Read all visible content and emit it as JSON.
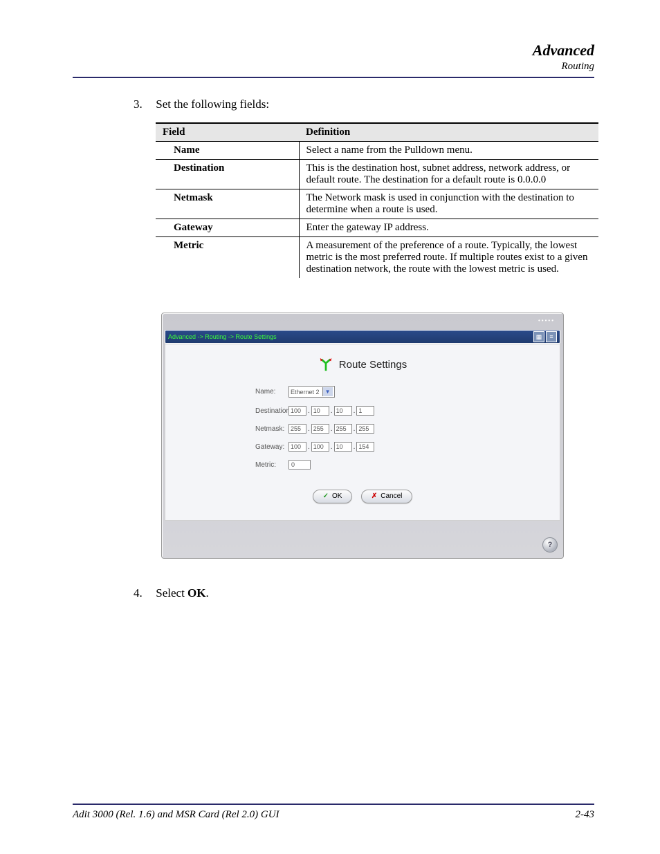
{
  "header": {
    "title": "Advanced",
    "subtitle": "Routing"
  },
  "step3": {
    "num": "3.",
    "text": "Set the following fields:"
  },
  "fields_table": {
    "headers": {
      "field": "Field",
      "definition": "Definition"
    },
    "rows": [
      {
        "name": "Name",
        "def": "Select a name from the Pulldown menu."
      },
      {
        "name": "Destination",
        "def": "This is the destination host, subnet address, network address, or default route. The destination for a default route is 0.0.0.0"
      },
      {
        "name": "Netmask",
        "def": "The Network mask is used in conjunction with the destination to determine when a route is used."
      },
      {
        "name": "Gateway",
        "def": "Enter the gateway IP address."
      },
      {
        "name": "Metric",
        "def": "A measurement of the preference of a route. Typically, the lowest metric is the most preferred route. If multiple routes exist to a given destination network, the route with the lowest metric is used."
      }
    ]
  },
  "app": {
    "breadcrumb": "Advanced -> Routing -> Route Settings",
    "title": "Route Settings",
    "labels": {
      "name": "Name:",
      "destination": "Destination:",
      "netmask": "Netmask:",
      "gateway": "Gateway:",
      "metric": "Metric:"
    },
    "values": {
      "name": "Ethernet 2",
      "destination": [
        "100",
        "10",
        "10",
        "1"
      ],
      "netmask": [
        "255",
        "255",
        "255",
        "255"
      ],
      "gateway": [
        "100",
        "100",
        "10",
        "154"
      ],
      "metric": "0"
    },
    "buttons": {
      "ok": "OK",
      "cancel": "Cancel"
    }
  },
  "step4": {
    "num": "4.",
    "prefix": "Select ",
    "bold": "OK",
    "suffix": "."
  },
  "footer": {
    "left": "Adit 3000 (Rel. 1.6) and MSR Card (Rel 2.0) GUI",
    "right": "2-43"
  }
}
